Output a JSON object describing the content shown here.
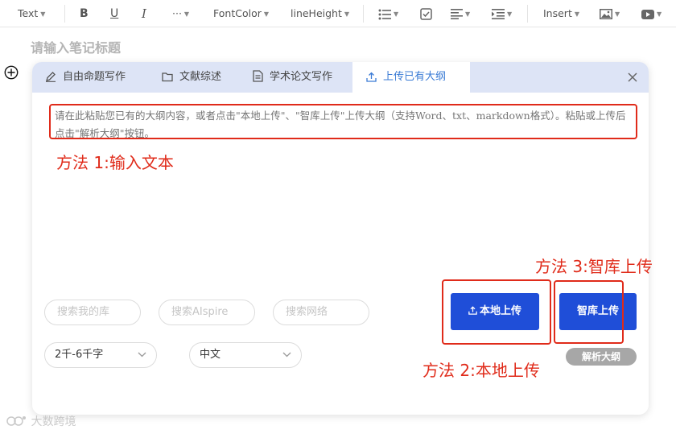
{
  "toolbar": {
    "text_label": "Text",
    "more_label": "···",
    "font_color_label": "FontColor",
    "line_height_label": "lineHeight",
    "insert_label": "Insert"
  },
  "editor": {
    "title_placeholder": "请输入笔记标题"
  },
  "panel": {
    "tabs": [
      {
        "label": "自由命题写作",
        "icon": "pen-icon"
      },
      {
        "label": "文献综述",
        "icon": "folder-icon"
      },
      {
        "label": "学术论文写作",
        "icon": "document-icon"
      },
      {
        "label": "上传已有大纲",
        "icon": "upload-icon",
        "active": true
      }
    ],
    "textarea_placeholder": "请在此粘贴您已有的大纲内容，或者点击\"本地上传\"、\"智库上传\"上传大纲（支持Word、txt、markdown格式）。粘贴或上传后点击\"解析大纲\"按钮。",
    "search_pills": [
      "搜索我的库",
      "搜索AIspire",
      "搜索网络"
    ],
    "length_select": "2千-6千字",
    "language_select": "中文",
    "local_upload_label": "本地上传",
    "kb_upload_label": "智库上传",
    "parse_label": "解析大纲"
  },
  "annotations": {
    "method1": "方法 1:输入文本",
    "method2": "方法 2:本地上传",
    "method3": "方法 3:智库上传"
  },
  "watermark": "大数跨境",
  "colors": {
    "accent_blue": "#1f4ed8",
    "active_tab_text": "#3a7bd5",
    "tab_bar": "#dde4f6",
    "annotation_red": "#e02b1a"
  }
}
